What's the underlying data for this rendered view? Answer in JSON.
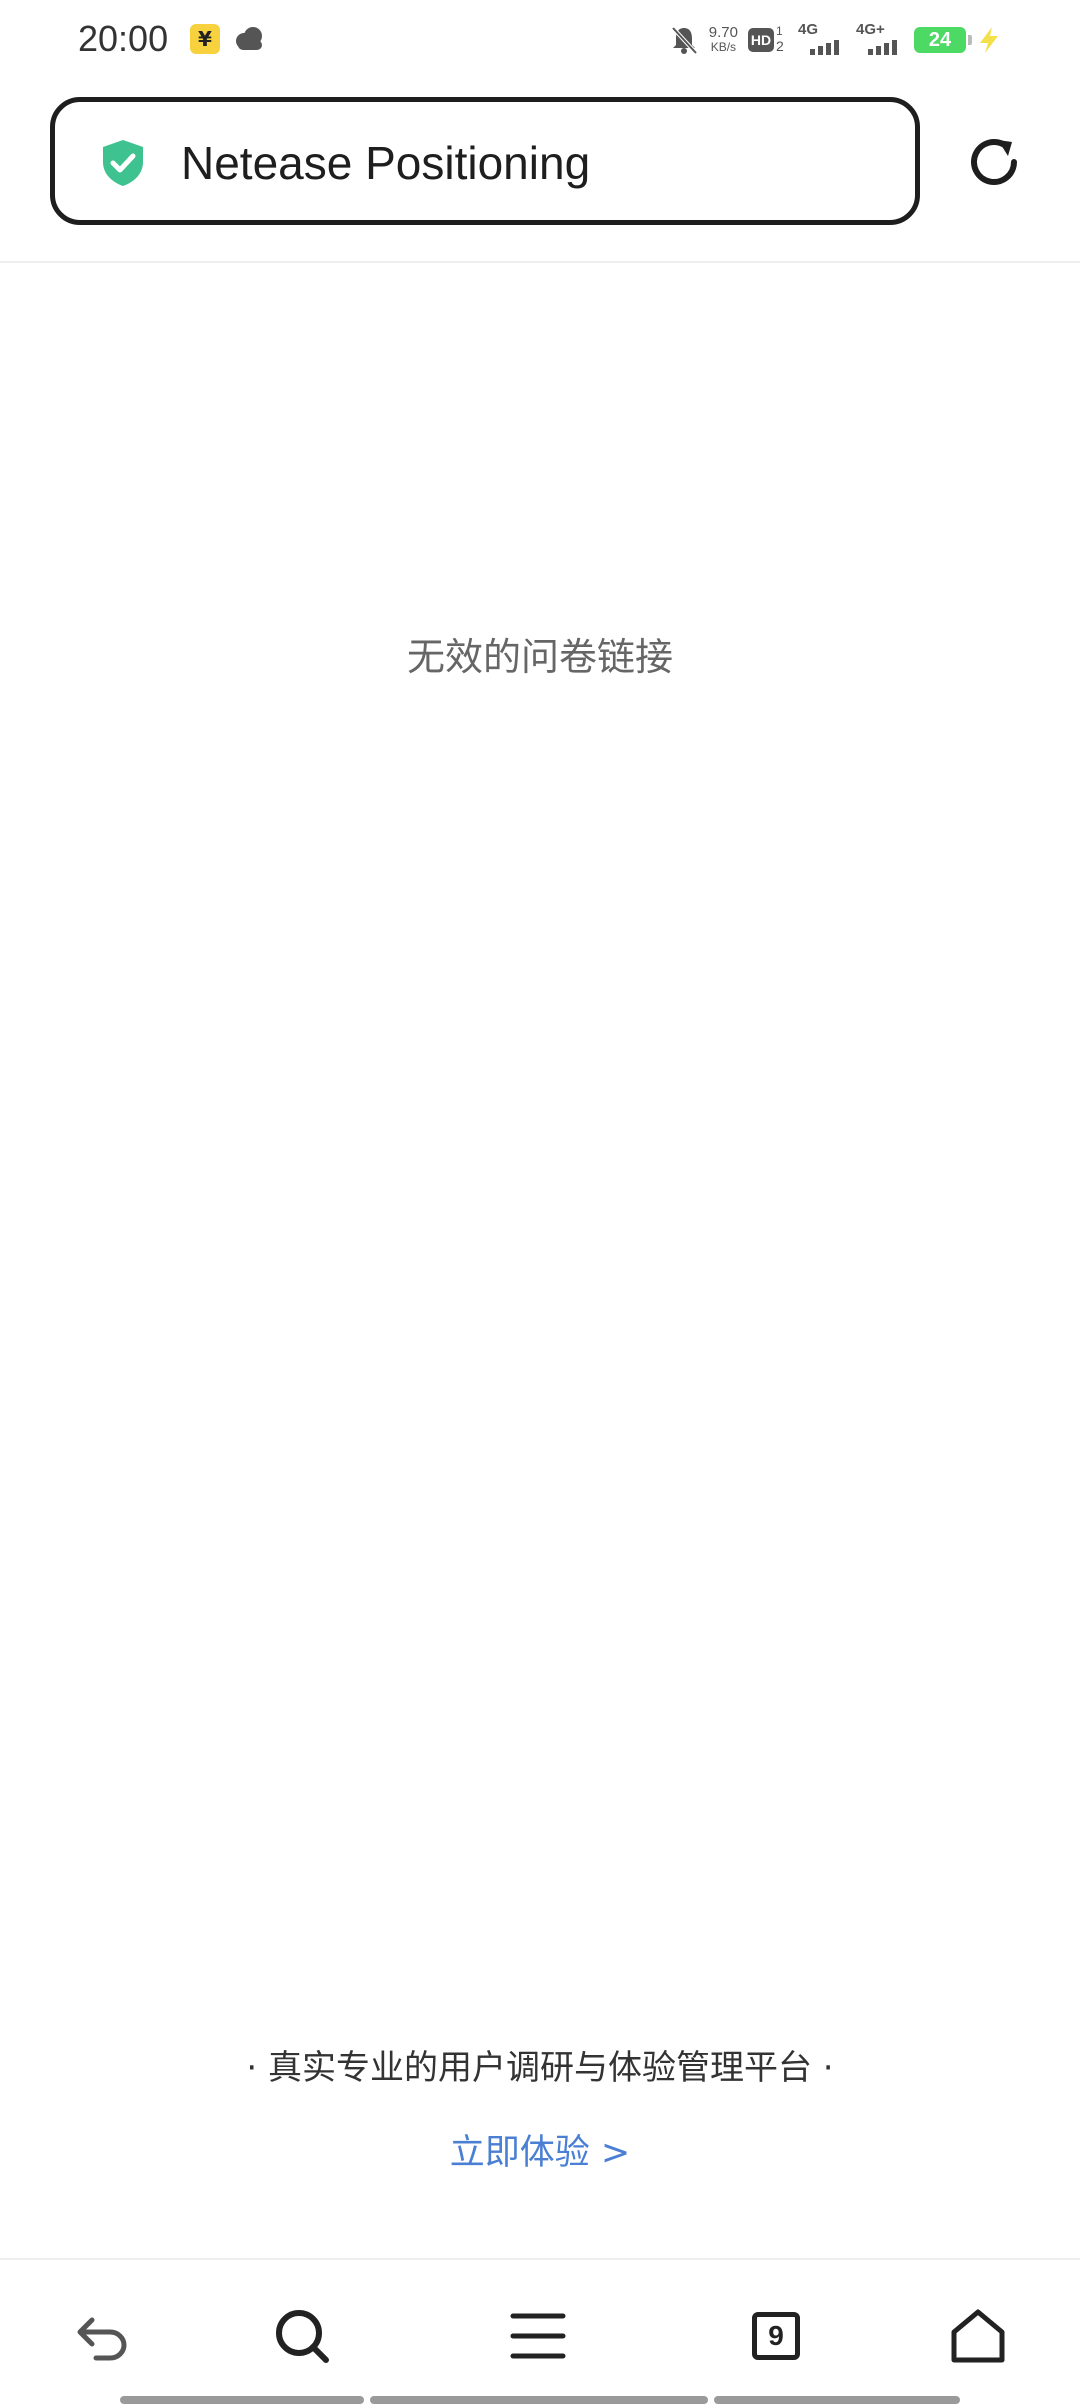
{
  "status_bar": {
    "time": "20:00",
    "app_icon_glyph": "¥",
    "net_speed_value": "9.70",
    "net_speed_unit": "KB/s",
    "hd_label": "HD",
    "hd_sim1": "1",
    "hd_sim2": "2",
    "signal1_label": "4G",
    "signal2_label": "4G+",
    "battery_level": "24"
  },
  "address_bar": {
    "title": "Netease Positioning",
    "secure_icon": "shield-check-icon",
    "secure_color": "#3ec28f"
  },
  "main": {
    "message": "无效的问卷链接"
  },
  "footer": {
    "slogan": "· 真实专业的用户调研与体验管理平台 ·",
    "cta": "立即体验 >"
  },
  "bottom_nav": {
    "back_icon": "back-arrow-icon",
    "search_icon": "search-icon",
    "menu_icon": "menu-icon",
    "tabs_count": "9",
    "home_icon": "home-icon"
  },
  "colors": {
    "accent_link": "#4a7fd4",
    "battery": "#4cd964",
    "status_app_icon": "#f7d23e"
  }
}
